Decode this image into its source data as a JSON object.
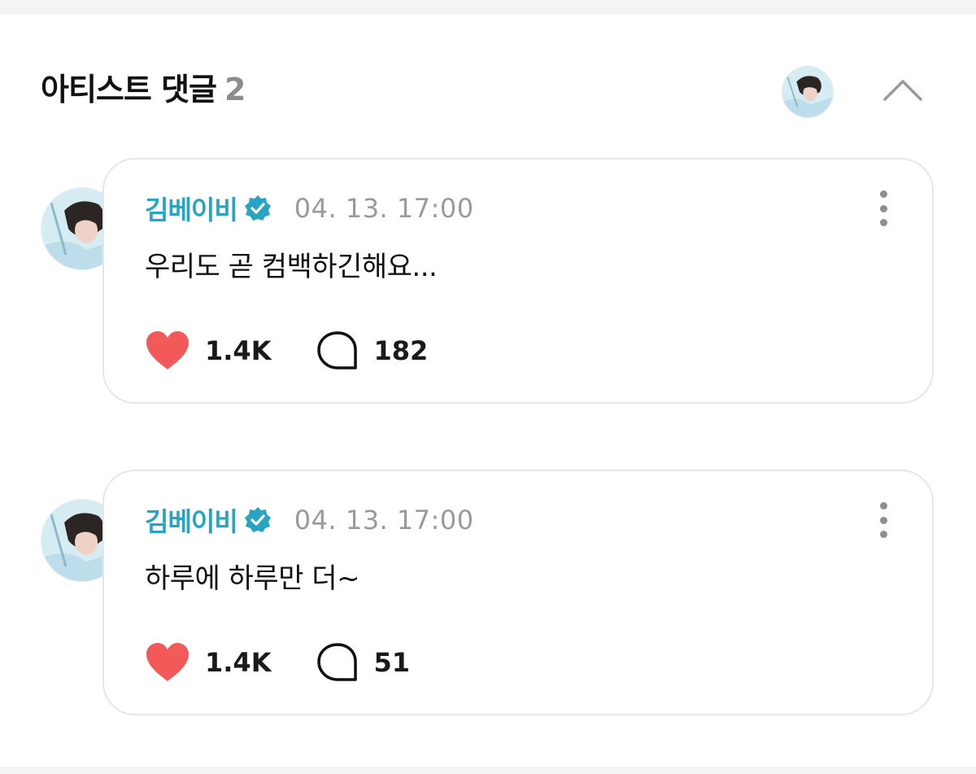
{
  "section": {
    "title": "아티스트 댓글",
    "count": "2"
  },
  "colors": {
    "accent": "#27a4c2",
    "like": "#f25a5a",
    "timestamp": "#9a9a9a"
  },
  "comments": [
    {
      "author": "김베이비",
      "time": "04. 13. 17:00",
      "text": "우리도 곧 컴백하긴해요...",
      "likes": "1.4K",
      "replies": "182"
    },
    {
      "author": "김베이비",
      "time": "04. 13. 17:00",
      "text": "하루에 하루만 더~",
      "likes": "1.4K",
      "replies": "51"
    }
  ]
}
